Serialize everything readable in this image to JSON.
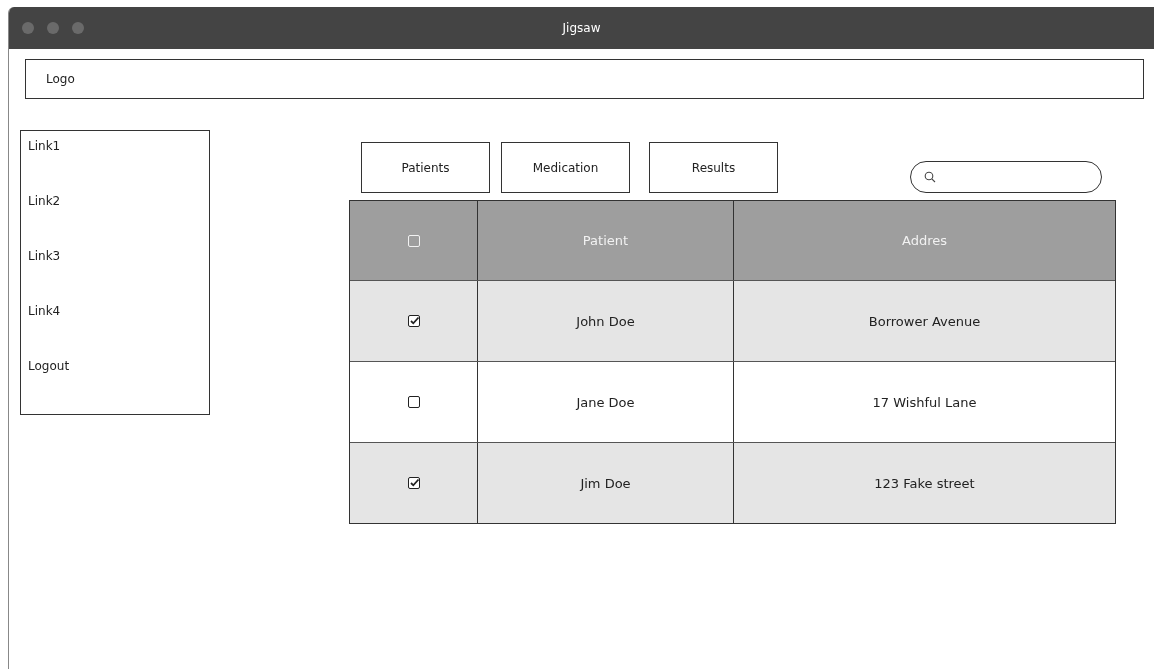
{
  "window": {
    "title": "Jigsaw"
  },
  "header": {
    "logo": "Logo"
  },
  "sidebar": {
    "items": [
      {
        "label": "Link1"
      },
      {
        "label": "Link2"
      },
      {
        "label": "Link3"
      },
      {
        "label": "Link4"
      },
      {
        "label": "Logout"
      }
    ]
  },
  "tabs": [
    {
      "label": "Patients"
    },
    {
      "label": "Medication"
    },
    {
      "label": "Results"
    }
  ],
  "table": {
    "header_checked": false,
    "columns": [
      "Patient",
      "Addres"
    ],
    "rows": [
      {
        "checked": true,
        "cells": [
          "John Doe",
          "Borrower Avenue"
        ]
      },
      {
        "checked": false,
        "cells": [
          "Jane Doe",
          "17 Wishful Lane"
        ]
      },
      {
        "checked": true,
        "cells": [
          "Jim Doe",
          "123 Fake street"
        ]
      }
    ]
  }
}
